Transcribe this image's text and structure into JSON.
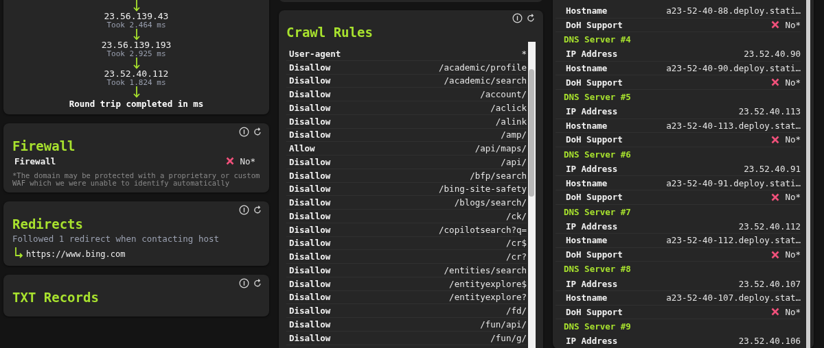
{
  "traceroute": {
    "hops": [
      {
        "ip": "23.56.139.43",
        "time": "Took 2.464 ms"
      },
      {
        "ip": "23.56.139.193",
        "time": "Took 2.925 ms"
      },
      {
        "ip": "23.52.40.112",
        "time": "Took 1.824 ms"
      }
    ],
    "summary": "Round trip completed in ms"
  },
  "firewall": {
    "title": "Firewall",
    "rows": [
      {
        "label": "Firewall",
        "supported": false,
        "value": "No*"
      }
    ],
    "note": "*The domain may be protected with a proprietary or custom WAF which we were unable to identify automatically"
  },
  "redirects": {
    "title": "Redirects",
    "summary": "Followed 1 redirect when contacting host",
    "targets": [
      "https://www.bing.com"
    ]
  },
  "txt_records": {
    "title": "TXT Records"
  },
  "crawl_rules": {
    "title": "Crawl Rules",
    "rules": [
      {
        "directive": "User-agent",
        "path": "*"
      },
      {
        "directive": "Disallow",
        "path": "/academic/profile"
      },
      {
        "directive": "Disallow",
        "path": "/academic/search"
      },
      {
        "directive": "Disallow",
        "path": "/account/"
      },
      {
        "directive": "Disallow",
        "path": "/aclick"
      },
      {
        "directive": "Disallow",
        "path": "/alink"
      },
      {
        "directive": "Disallow",
        "path": "/amp/"
      },
      {
        "directive": "Allow",
        "path": "/api/maps/"
      },
      {
        "directive": "Disallow",
        "path": "/api/"
      },
      {
        "directive": "Disallow",
        "path": "/bfp/search"
      },
      {
        "directive": "Disallow",
        "path": "/bing-site-safety"
      },
      {
        "directive": "Disallow",
        "path": "/blogs/search/"
      },
      {
        "directive": "Disallow",
        "path": "/ck/"
      },
      {
        "directive": "Disallow",
        "path": "/copilotsearch?q="
      },
      {
        "directive": "Disallow",
        "path": "/cr$"
      },
      {
        "directive": "Disallow",
        "path": "/cr?"
      },
      {
        "directive": "Disallow",
        "path": "/entities/search"
      },
      {
        "directive": "Disallow",
        "path": "/entityexplore$"
      },
      {
        "directive": "Disallow",
        "path": "/entityexplore?"
      },
      {
        "directive": "Disallow",
        "path": "/fd/"
      },
      {
        "directive": "Disallow",
        "path": "/fun/api/"
      },
      {
        "directive": "Disallow",
        "path": "/fun/g/"
      }
    ]
  },
  "dns_servers": {
    "items": [
      {
        "kind": "field",
        "label": "Hostname",
        "value": "a23-52-40-88.deploy.stati…"
      },
      {
        "kind": "doh",
        "label": "DoH Support",
        "supported": false,
        "value": "No*"
      },
      {
        "kind": "heading",
        "label": "DNS Server #4"
      },
      {
        "kind": "field",
        "label": "IP Address",
        "value": "23.52.40.90"
      },
      {
        "kind": "field",
        "label": "Hostname",
        "value": "a23-52-40-90.deploy.stati…"
      },
      {
        "kind": "doh",
        "label": "DoH Support",
        "supported": false,
        "value": "No*"
      },
      {
        "kind": "heading",
        "label": "DNS Server #5"
      },
      {
        "kind": "field",
        "label": "IP Address",
        "value": "23.52.40.113"
      },
      {
        "kind": "field",
        "label": "Hostname",
        "value": "a23-52-40-113.deploy.stat…"
      },
      {
        "kind": "doh",
        "label": "DoH Support",
        "supported": false,
        "value": "No*"
      },
      {
        "kind": "heading",
        "label": "DNS Server #6"
      },
      {
        "kind": "field",
        "label": "IP Address",
        "value": "23.52.40.91"
      },
      {
        "kind": "field",
        "label": "Hostname",
        "value": "a23-52-40-91.deploy.stati…"
      },
      {
        "kind": "doh",
        "label": "DoH Support",
        "supported": false,
        "value": "No*"
      },
      {
        "kind": "heading",
        "label": "DNS Server #7"
      },
      {
        "kind": "field",
        "label": "IP Address",
        "value": "23.52.40.112"
      },
      {
        "kind": "field",
        "label": "Hostname",
        "value": "a23-52-40-112.deploy.stat…"
      },
      {
        "kind": "doh",
        "label": "DoH Support",
        "supported": false,
        "value": "No*"
      },
      {
        "kind": "heading",
        "label": "DNS Server #8"
      },
      {
        "kind": "field",
        "label": "IP Address",
        "value": "23.52.40.107"
      },
      {
        "kind": "field",
        "label": "Hostname",
        "value": "a23-52-40-107.deploy.stat…"
      },
      {
        "kind": "doh",
        "label": "DoH Support",
        "supported": false,
        "value": "No*"
      },
      {
        "kind": "heading",
        "label": "DNS Server #9"
      },
      {
        "kind": "field",
        "label": "IP Address",
        "value": "23.52.40.106"
      }
    ]
  }
}
